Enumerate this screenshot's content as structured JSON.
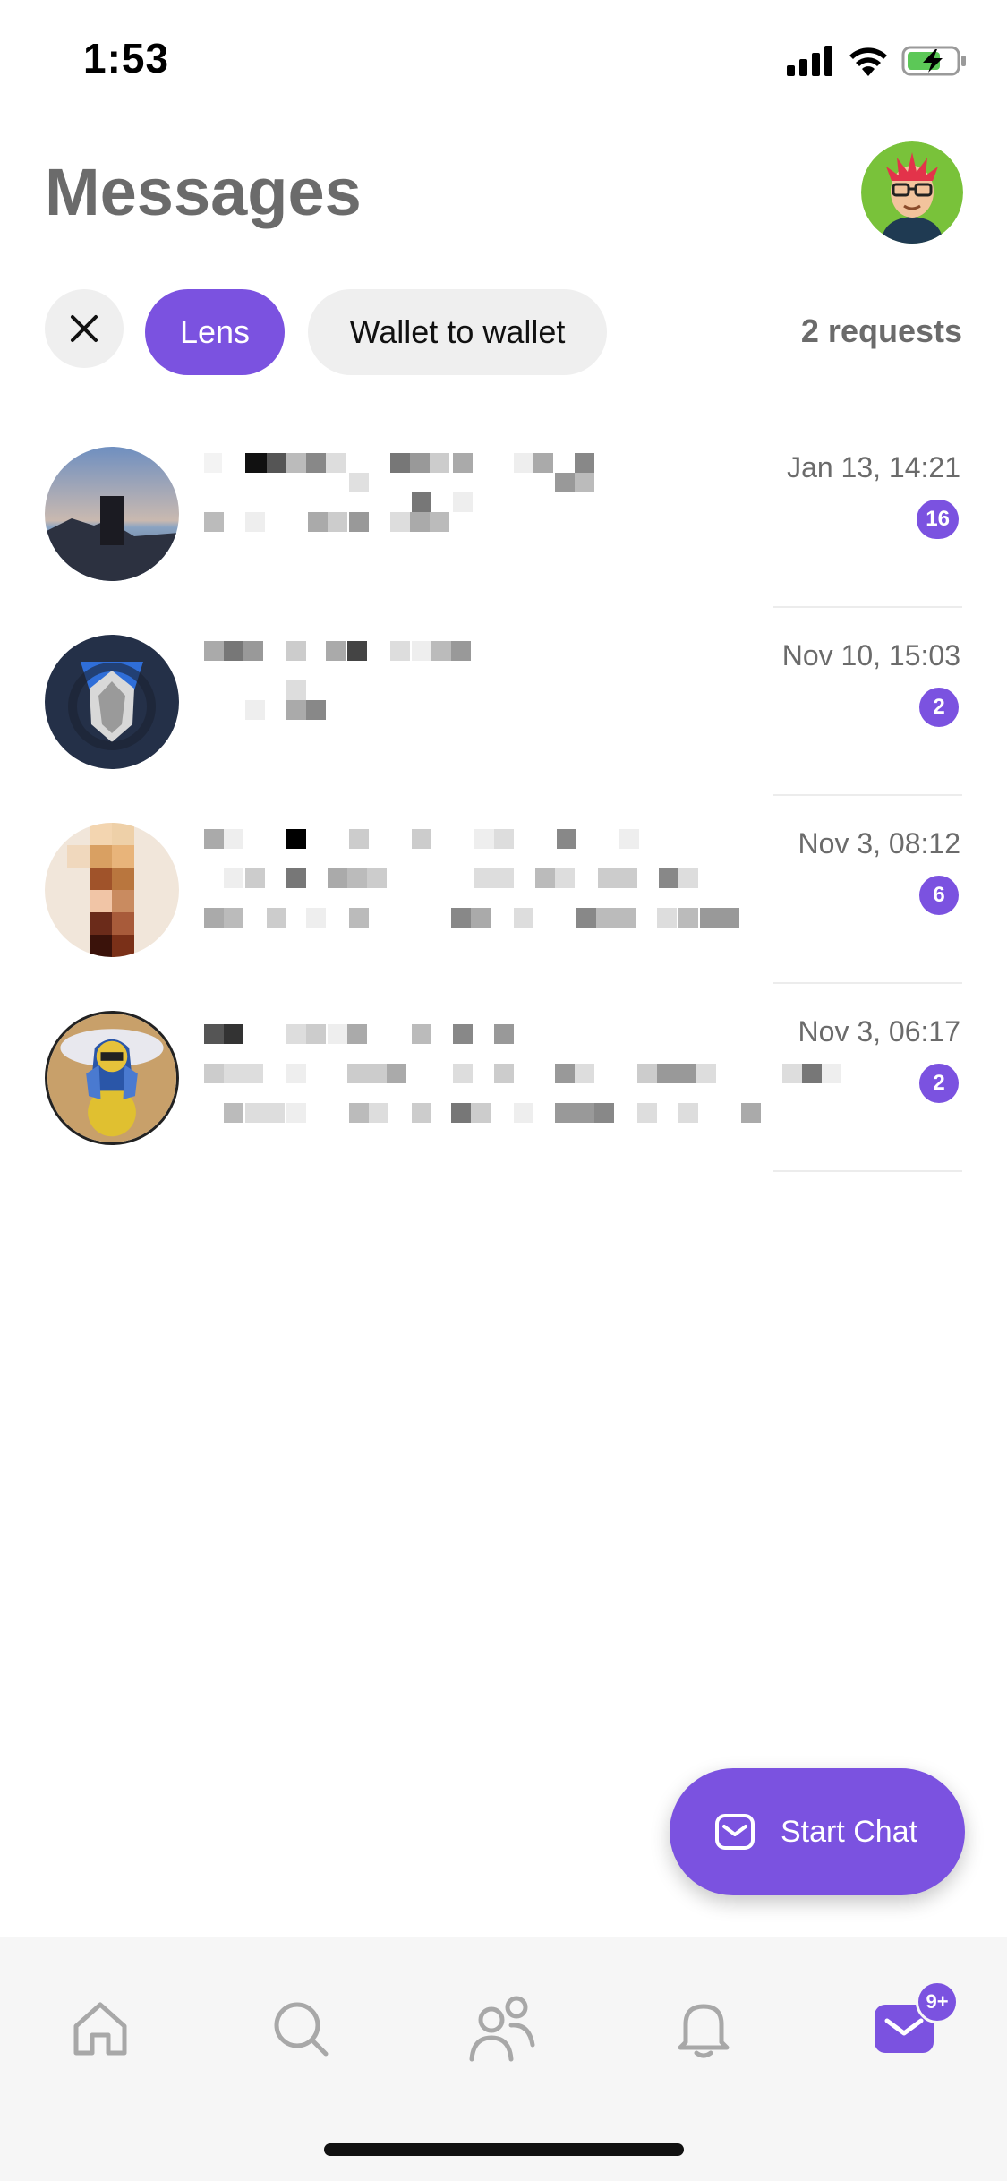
{
  "status_bar": {
    "time": "1:53",
    "icons": [
      "signal-icon",
      "wifi-icon",
      "battery-charging-icon"
    ]
  },
  "header": {
    "title": "Messages",
    "profile_avatar": "profile-avatar"
  },
  "filters": {
    "close_icon": "close-icon",
    "chips": [
      {
        "label": "Lens",
        "selected": true
      },
      {
        "label": "Wallet to wallet",
        "selected": false
      }
    ],
    "requests_label": "2 requests"
  },
  "conversations": [
    {
      "time": "Jan 13, 14:21",
      "unread": "16"
    },
    {
      "time": "Nov 10, 15:03",
      "unread": "2"
    },
    {
      "time": "Nov 3, 08:12",
      "unread": "6"
    },
    {
      "time": "Nov 3, 06:17",
      "unread": "2"
    }
  ],
  "fab": {
    "label": "Start Chat",
    "icon": "envelope-icon"
  },
  "tab_bar": {
    "items": [
      "home-icon",
      "search-icon",
      "people-icon",
      "bell-icon",
      "messages-icon"
    ],
    "active": "messages-icon",
    "messages_badge": "9+"
  },
  "colors": {
    "accent": "#7b52e0",
    "chip_bg": "#efefef",
    "muted_text": "#6b6b6b",
    "tab_bar_bg": "#f6f6f6"
  }
}
